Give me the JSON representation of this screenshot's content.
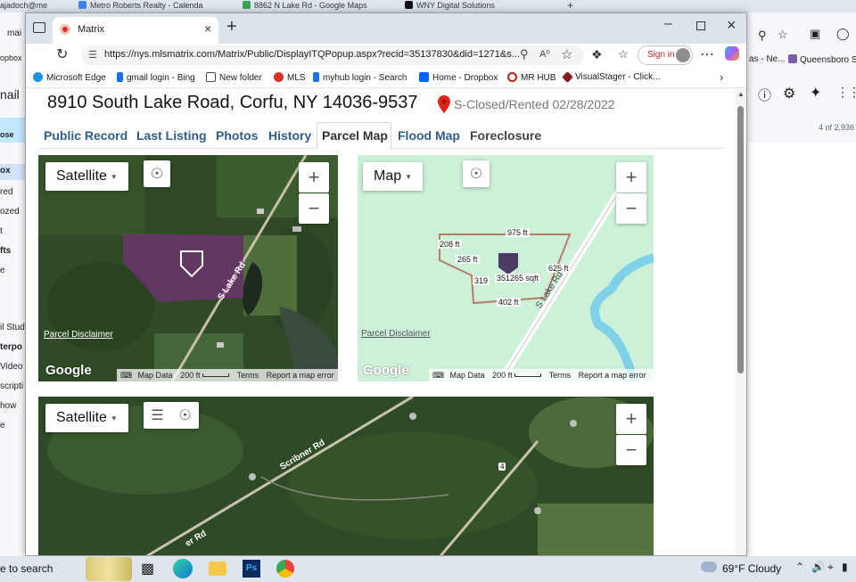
{
  "background_tabs": [
    {
      "label": "ajadoch@me",
      "color": "#d93025"
    },
    {
      "label": "Metro Roberts Realty - Calenda",
      "color": "#4285f4"
    },
    {
      "label": "8862 N Lake Rd - Google Maps",
      "color": "#34a853"
    },
    {
      "label": "WNY Digital Solutions",
      "color": "#111111"
    }
  ],
  "bg_new_tab": "+",
  "gmail_left": [
    "mai",
    "opbox",
    "nail",
    "ose",
    "ox",
    "red",
    "ozed",
    "t",
    "fts",
    "e",
    "il Stud",
    "terpo",
    "Video",
    "scripti",
    "how",
    "e"
  ],
  "gmail_right": {
    "nav_text": "as - Ne...",
    "bookmark": "Queensboro S",
    "count": "4 of 2,936"
  },
  "window": {
    "tab_title": "Matrix",
    "url": "https://nys.mlsmatrix.com/Matrix/Public/DisplayITQPopup.aspx?recid=35137830&did=1271&s...",
    "sign_in": "Sign in"
  },
  "favorites": [
    {
      "label": "Microsoft Edge",
      "icon": "edge-icon",
      "color": "#1d8fe0"
    },
    {
      "label": "gmail login - Bing",
      "icon": "bing-icon",
      "color": "#1b72e8"
    },
    {
      "label": "New folder",
      "icon": "folder-icon",
      "color": "#444444"
    },
    {
      "label": "MLS",
      "icon": "mls-icon",
      "color": "#d93025"
    },
    {
      "label": "myhub login - Search",
      "icon": "bing-icon",
      "color": "#1b72e8"
    },
    {
      "label": "Home - Dropbox",
      "icon": "dropbox-icon",
      "color": "#0061fe"
    },
    {
      "label": "MR HUB",
      "icon": "mrhub-icon",
      "color": "#b3261e"
    },
    {
      "label": "VisualStager - Click...",
      "icon": "visualstager-icon",
      "color": "#8b1a1a"
    }
  ],
  "listing": {
    "address": "8910 South Lake Road, Corfu, NY 14036-9537",
    "status": "S-Closed/Rented 02/28/2022",
    "status_color": "#e0241b"
  },
  "tabs": [
    "Public Record",
    "Last Listing",
    "Photos",
    "History",
    "Parcel Map",
    "Flood Map",
    "Foreclosure"
  ],
  "active_tab": "Parcel Map",
  "map_satellite": {
    "type_label": "Satellite",
    "road_label": "S Lake Rd",
    "disclaimer": "Parcel Disclaimer",
    "logo": "Google",
    "attribution": {
      "map_data": "Map Data",
      "scale": "200 ft",
      "terms": "Terms",
      "report": "Report a map error"
    }
  },
  "map_road": {
    "type_label": "Map",
    "road_label": "S Lake Rd",
    "dimensions": [
      "975 ft",
      "208 ft",
      "265 ft",
      "625 ft",
      "319",
      "402 ft"
    ],
    "area": "351265 sqft",
    "disclaimer": "Parcel Disclaimer",
    "logo": "Google",
    "attribution": {
      "map_data": "Map Data",
      "scale": "200 ft",
      "terms": "Terms",
      "report": "Report a map error"
    }
  },
  "map_bottom": {
    "type_label": "Satellite",
    "road_labels": [
      "Scribner Rd",
      "er Rd"
    ],
    "route_shield": "4"
  },
  "taskbar": {
    "search_text": "e to search",
    "weather": "69°F  Cloudy"
  }
}
